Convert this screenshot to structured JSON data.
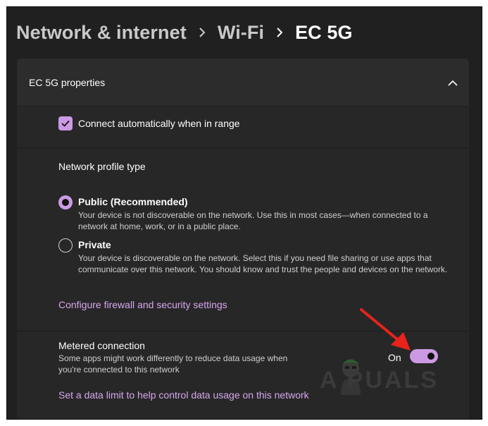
{
  "breadcrumb": {
    "items": [
      "Network & internet",
      "Wi-Fi"
    ],
    "current": "EC 5G"
  },
  "properties": {
    "header_title": "EC 5G properties",
    "connect_auto": {
      "label": "Connect automatically when in range",
      "checked": true
    },
    "profile": {
      "section_title": "Network profile type",
      "options": [
        {
          "title": "Public (Recommended)",
          "description": "Your device is not discoverable on the network. Use this in most cases—when connected to a network at home, work, or in a public place.",
          "selected": true
        },
        {
          "title": "Private",
          "description": "Your device is discoverable on the network. Select this if you need file sharing or use apps that communicate over this network. You should know and trust the people and devices on the network.",
          "selected": false
        }
      ],
      "firewall_link": "Configure firewall and security settings"
    },
    "metered": {
      "title": "Metered connection",
      "description": "Some apps might work differently to reduce data usage when you're connected to this network",
      "toggle_state": "On",
      "toggle_on": true,
      "data_limit_link": "Set a data limit to help control data usage on this network"
    }
  },
  "watermark": {
    "text": "A PUALS"
  },
  "colors": {
    "accent": "#cc9ae4",
    "link": "#d7a7ef",
    "background": "#202020",
    "card": "#272727",
    "arrow": "#e8231c"
  },
  "icons": {
    "breadcrumb_separator": "chevron-right-icon",
    "collapse": "chevron-up-icon",
    "checkbox": "checkmark-icon",
    "annotation": "red-arrow-icon"
  }
}
